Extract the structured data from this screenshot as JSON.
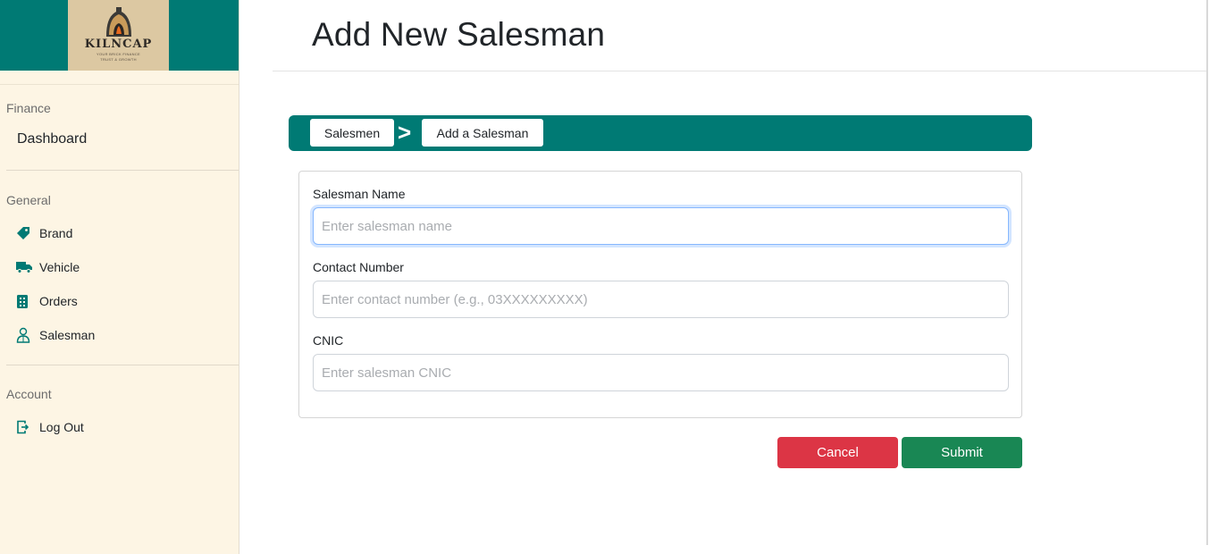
{
  "brand": {
    "name": "KILNCAP",
    "tagline_1": "YOUR BRICK FINANCE",
    "tagline_2": "TRUST & GROWTH"
  },
  "sidebar": {
    "finance_label": "Finance",
    "dashboard_label": "Dashboard",
    "general_label": "General",
    "items": [
      {
        "label": "Brand",
        "icon": "tag-icon"
      },
      {
        "label": "Vehicle",
        "icon": "truck-icon"
      },
      {
        "label": "Orders",
        "icon": "orders-list-icon"
      },
      {
        "label": "Salesman",
        "icon": "salesman-user-icon"
      }
    ],
    "account_label": "Account",
    "logout_label": "Log Out"
  },
  "page": {
    "title": "Add New Salesman"
  },
  "breadcrumb": {
    "items": [
      "Salesmen",
      "Add a Salesman"
    ],
    "separator": ">"
  },
  "form": {
    "name": {
      "label": "Salesman Name",
      "placeholder": "Enter salesman name",
      "value": ""
    },
    "contact": {
      "label": "Contact Number",
      "placeholder": "Enter contact number (e.g., 03XXXXXXXXX)",
      "value": ""
    },
    "cnic": {
      "label": "CNIC",
      "placeholder": "Enter salesman CNIC",
      "value": ""
    }
  },
  "actions": {
    "cancel_label": "Cancel",
    "submit_label": "Submit"
  },
  "colors": {
    "primary_teal": "#007a74",
    "sidebar_bg": "#fdf5e4",
    "cancel_red": "#dc3545",
    "submit_green": "#198754"
  }
}
